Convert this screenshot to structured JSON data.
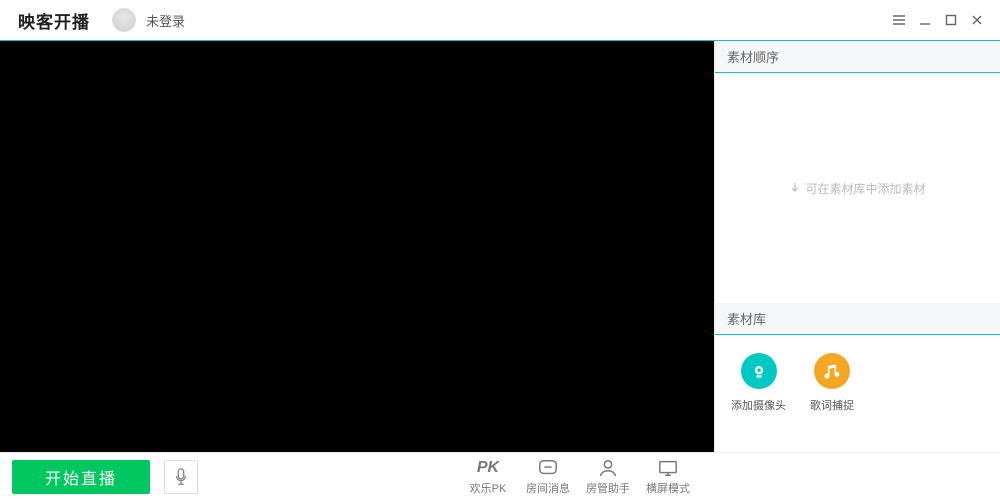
{
  "titlebar": {
    "app_name": "映客开播",
    "login_status": "未登录"
  },
  "sidebar": {
    "order_header": "素材顺序",
    "order_hint": "可在素材库中添加素材",
    "library_header": "素材库",
    "items": [
      {
        "label": "添加摄像头"
      },
      {
        "label": "歌词捕捉"
      }
    ]
  },
  "bottombar": {
    "start_label": "开始直播",
    "tools": [
      {
        "label": "欢乐PK"
      },
      {
        "label": "房间消息"
      },
      {
        "label": "房管助手"
      },
      {
        "label": "横屏模式"
      }
    ]
  }
}
